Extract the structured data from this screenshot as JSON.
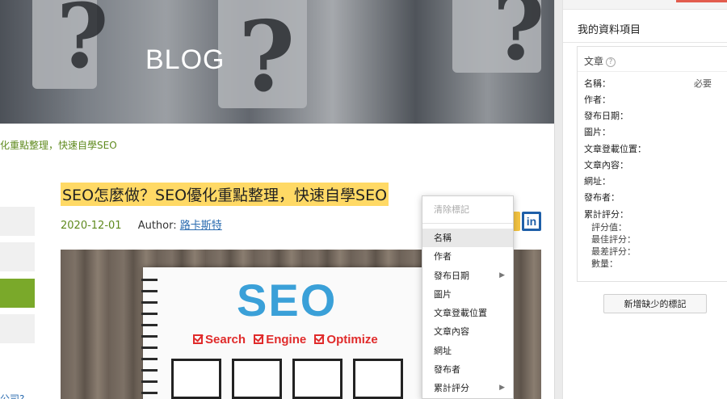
{
  "hero": {
    "title": "BLOG"
  },
  "breadcrumb": "化重點整理，快速自學SEO",
  "post": {
    "title": "SEO怎麼做？SEO優化重點整理，快速自學SEO",
    "date": "2020-12-01",
    "author_label": "Author:",
    "author_name": "路卡斯特"
  },
  "image": {
    "headline": "SEO",
    "tags": [
      "Search",
      "Engine",
      "Optimize"
    ]
  },
  "partial_link": "公司?",
  "context_menu": {
    "clear": "清除標記",
    "items": [
      {
        "label": "名稱",
        "submenu": false
      },
      {
        "label": "作者",
        "submenu": false
      },
      {
        "label": "發布日期",
        "submenu": true
      },
      {
        "label": "圖片",
        "submenu": false
      },
      {
        "label": "文章登載位置",
        "submenu": false
      },
      {
        "label": "文章內容",
        "submenu": false
      },
      {
        "label": "網址",
        "submenu": false
      },
      {
        "label": "發布者",
        "submenu": false
      },
      {
        "label": "累計評分",
        "submenu": true
      }
    ],
    "submenu_arrow": "▶"
  },
  "panel": {
    "title": "我的資料項目",
    "card_title": "文章",
    "help_glyph": "?",
    "required": "必要",
    "fields": [
      "名稱：",
      "作者：",
      "發布日期：",
      "圖片：",
      "文章登載位置：",
      "文章內容：",
      "網址：",
      "發布者：",
      "累計評分："
    ],
    "rating_subfields": [
      "評分值：",
      "最佳評分：",
      "最差評分：",
      "數量："
    ],
    "add_button": "新增缺少的標記"
  },
  "colors": {
    "highlight": "#ffd965",
    "green": "#7aa92a",
    "link": "#2b6cb0",
    "linkedin": "#1e5fa8"
  }
}
